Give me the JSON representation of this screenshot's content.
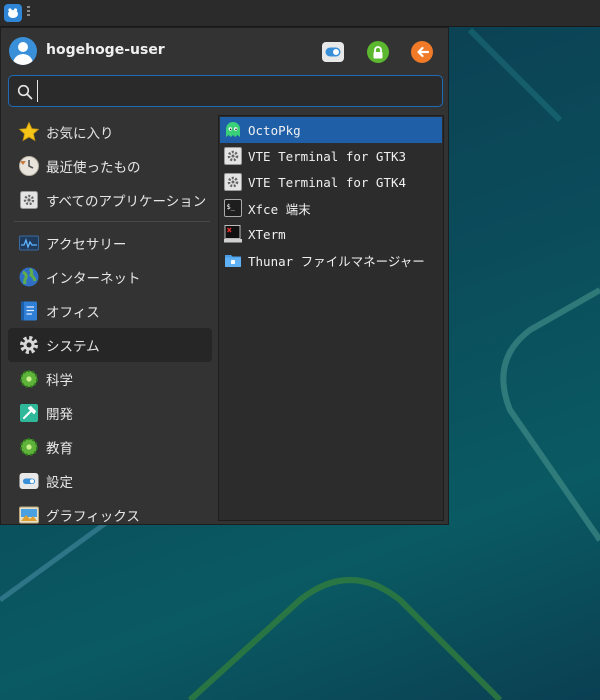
{
  "user": {
    "name": "hogehoge-user"
  },
  "search": {
    "placeholder": "",
    "value": ""
  },
  "categories": [
    {
      "label": "お気に入り",
      "icon": "star-icon"
    },
    {
      "label": "最近使ったもの",
      "icon": "recent-icon"
    },
    {
      "label": "すべてのアプリケーション",
      "icon": "all-apps-icon"
    },
    {
      "label": "アクセサリー",
      "icon": "accessories-icon"
    },
    {
      "label": "インターネット",
      "icon": "globe-icon"
    },
    {
      "label": "オフィス",
      "icon": "office-icon"
    },
    {
      "label": "システム",
      "icon": "gear-icon"
    },
    {
      "label": "科学",
      "icon": "science-icon"
    },
    {
      "label": "開発",
      "icon": "development-icon"
    },
    {
      "label": "教育",
      "icon": "education-icon"
    },
    {
      "label": "設定",
      "icon": "settings-icon"
    },
    {
      "label": "グラフィックス",
      "icon": "graphics-icon"
    }
  ],
  "active_category": "システム",
  "apps": [
    {
      "label": "OctoPkg",
      "icon": "octopkg-icon"
    },
    {
      "label": "VTE Terminal for GTK3",
      "icon": "vte-gear-icon"
    },
    {
      "label": "VTE Terminal for GTK4",
      "icon": "vte-gear-icon"
    },
    {
      "label": "Xfce 端末",
      "icon": "terminal-icon"
    },
    {
      "label": "XTerm",
      "icon": "xterm-icon"
    },
    {
      "label": "Thunar ファイルマネージャー",
      "icon": "thunar-icon"
    }
  ],
  "selected_app": "OctoPkg",
  "colors": {
    "accent": "#1f5fa8",
    "menu_bg": "#333333",
    "search_border": "#1e6bb8"
  }
}
